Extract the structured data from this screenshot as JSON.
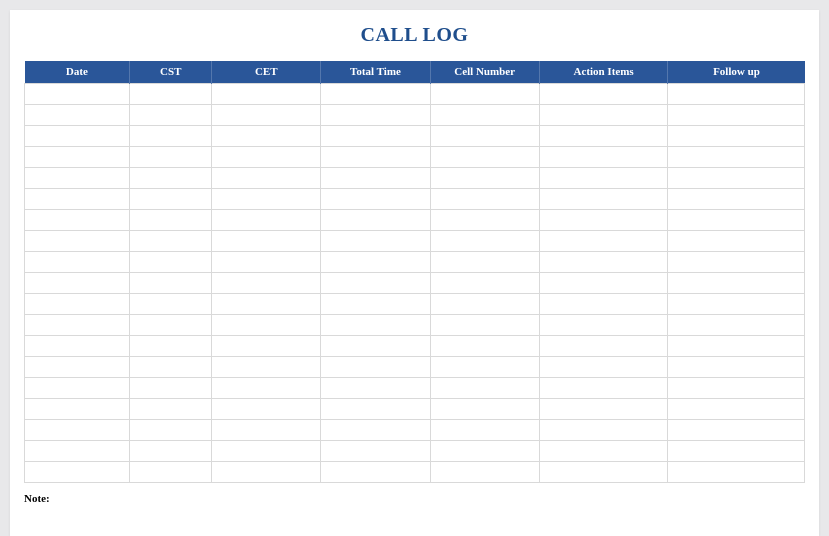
{
  "title": "CALL LOG",
  "columns": [
    "Date",
    "CST",
    "CET",
    "Total Time",
    "Cell Number",
    "Action Items",
    "Follow up"
  ],
  "rows": [
    [
      "",
      "",
      "",
      "",
      "",
      "",
      ""
    ],
    [
      "",
      "",
      "",
      "",
      "",
      "",
      ""
    ],
    [
      "",
      "",
      "",
      "",
      "",
      "",
      ""
    ],
    [
      "",
      "",
      "",
      "",
      "",
      "",
      ""
    ],
    [
      "",
      "",
      "",
      "",
      "",
      "",
      ""
    ],
    [
      "",
      "",
      "",
      "",
      "",
      "",
      ""
    ],
    [
      "",
      "",
      "",
      "",
      "",
      "",
      ""
    ],
    [
      "",
      "",
      "",
      "",
      "",
      "",
      ""
    ],
    [
      "",
      "",
      "",
      "",
      "",
      "",
      ""
    ],
    [
      "",
      "",
      "",
      "",
      "",
      "",
      ""
    ],
    [
      "",
      "",
      "",
      "",
      "",
      "",
      ""
    ],
    [
      "",
      "",
      "",
      "",
      "",
      "",
      ""
    ],
    [
      "",
      "",
      "",
      "",
      "",
      "",
      ""
    ],
    [
      "",
      "",
      "",
      "",
      "",
      "",
      ""
    ],
    [
      "",
      "",
      "",
      "",
      "",
      "",
      ""
    ],
    [
      "",
      "",
      "",
      "",
      "",
      "",
      ""
    ],
    [
      "",
      "",
      "",
      "",
      "",
      "",
      ""
    ],
    [
      "",
      "",
      "",
      "",
      "",
      "",
      ""
    ],
    [
      "",
      "",
      "",
      "",
      "",
      "",
      ""
    ]
  ],
  "note_label": "Note:"
}
